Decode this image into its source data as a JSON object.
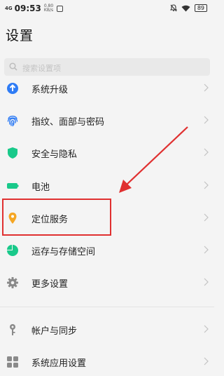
{
  "status_bar": {
    "signal": "4G",
    "time": "09:53",
    "speed_value": "0.80",
    "speed_unit": "KB/s",
    "battery": "89"
  },
  "page": {
    "title": "设置"
  },
  "search": {
    "placeholder": "搜索设置项"
  },
  "settings_items": [
    {
      "label": "系统升级",
      "icon": "system-update-icon",
      "color": "#2f7cf5"
    },
    {
      "label": "指纹、面部与密码",
      "icon": "fingerprint-icon",
      "color": "#2f7cf5"
    },
    {
      "label": "安全与隐私",
      "icon": "shield-icon",
      "color": "#19c98a"
    },
    {
      "label": "电池",
      "icon": "battery-icon",
      "color": "#19c98a"
    },
    {
      "label": "定位服务",
      "icon": "location-pin-icon",
      "color": "#f5a623"
    },
    {
      "label": "运存与存储空间",
      "icon": "storage-pie-icon",
      "color": "#19c98a"
    },
    {
      "label": "更多设置",
      "icon": "gear-icon",
      "color": "#8a8a8a"
    },
    {
      "label": "帐户与同步",
      "icon": "key-icon",
      "color": "#8a8a8a"
    },
    {
      "label": "系统应用设置",
      "icon": "apps-icon",
      "color": "#8a8a8a"
    }
  ],
  "annotation": {
    "highlight_color": "#e03030"
  }
}
